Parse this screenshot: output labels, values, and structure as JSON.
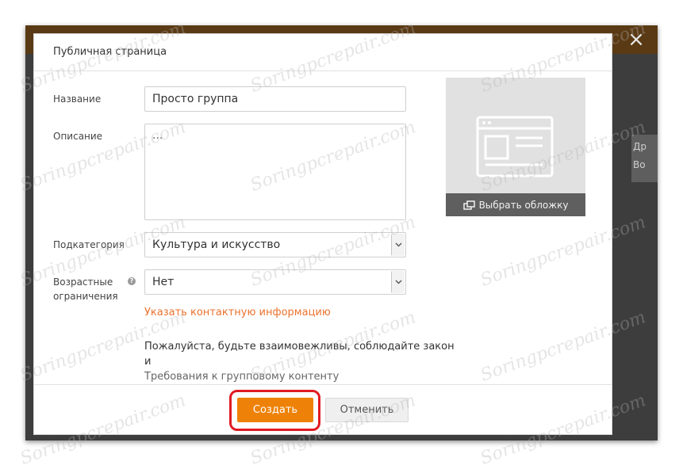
{
  "dialog": {
    "title": "Публичная страница",
    "close_icon": "close-icon",
    "name_label": "Название",
    "name_value": "Просто группа",
    "description_label": "Описание",
    "description_value": "...",
    "subcategory_label": "Подкатегория",
    "subcategory_value": "Культура и искусство",
    "age_label": "Возрастные ограничения",
    "age_value": "Нет",
    "contact_link": "Указать контактную информацию",
    "rules_text": "Пожалуйста, будьте взаимовежливы, соблюдайте закон и",
    "rules_link": "Требования к групповому контенту",
    "cover_button": "Выбрать обложку",
    "create_button": "Создать",
    "cancel_button": "Отменить"
  },
  "background": {
    "right_items": [
      "Др",
      "Во"
    ]
  },
  "watermark": "Soringpcrepair.com",
  "colors": {
    "accent": "#ee8208",
    "link": "#eb722e",
    "highlight": "#e01b22"
  }
}
